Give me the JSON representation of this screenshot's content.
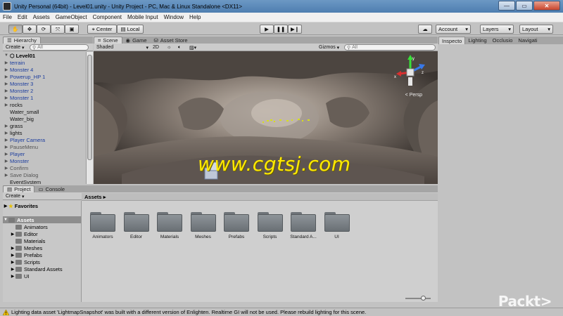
{
  "window": {
    "title": "Unity Personal (64bit) - Level01.unity - Unity Project - PC, Mac & Linux Standalone <DX11>"
  },
  "menu": [
    "File",
    "Edit",
    "Assets",
    "GameObject",
    "Component",
    "Mobile Input",
    "Window",
    "Help"
  ],
  "toolbar": {
    "pivot_label": "Center",
    "space_label": "Local",
    "account_label": "Account",
    "layers_label": "Layers",
    "layout_label": "Layout"
  },
  "hierarchy": {
    "tab": "Hierarchy",
    "create": "Create",
    "search_placeholder": "All",
    "scene_name": "Level01",
    "items": [
      {
        "label": "terrain",
        "style": "blue",
        "arrow": true
      },
      {
        "label": "Monster 4",
        "style": "blue",
        "arrow": true
      },
      {
        "label": "Powerup_HP 1",
        "style": "blue",
        "arrow": true
      },
      {
        "label": "Monster 3",
        "style": "blue",
        "arrow": true
      },
      {
        "label": "Monster 2",
        "style": "blue",
        "arrow": true
      },
      {
        "label": "Monster 1",
        "style": "blue",
        "arrow": true
      },
      {
        "label": "rocks",
        "style": "blk",
        "arrow": true
      },
      {
        "label": "Water_small",
        "style": "blk",
        "arrow": false
      },
      {
        "label": "Water_big",
        "style": "blk",
        "arrow": false
      },
      {
        "label": "grass",
        "style": "blk",
        "arrow": true
      },
      {
        "label": "lights",
        "style": "blk",
        "arrow": true
      },
      {
        "label": "Player Camera",
        "style": "blue",
        "arrow": true
      },
      {
        "label": "PauseMenu",
        "style": "dim",
        "arrow": true
      },
      {
        "label": "Player",
        "style": "blue",
        "arrow": true
      },
      {
        "label": "Monster",
        "style": "blue",
        "arrow": true
      },
      {
        "label": "Confirm",
        "style": "dim",
        "arrow": true
      },
      {
        "label": "Save Dialog",
        "style": "dim",
        "arrow": true
      },
      {
        "label": "EventSystem",
        "style": "blk",
        "arrow": false
      }
    ]
  },
  "scene": {
    "tabs": [
      "Scene",
      "Game",
      "Asset Store"
    ],
    "shading": "Shaded",
    "mode_2d": "2D",
    "gizmos": "Gizmos",
    "search_placeholder": "All",
    "persp_label": "< Persp",
    "watermark": "www.cgtsj.com"
  },
  "project": {
    "tabs": [
      "Project",
      "Console"
    ],
    "create": "Create",
    "favorites": "Favorites",
    "assets_root": "Assets",
    "tree": [
      "Animators",
      "Editor",
      "Materials",
      "Meshes",
      "Prefabs",
      "Scripts",
      "Standard Assets",
      "UI"
    ],
    "breadcrumb": "Assets",
    "grid_items": [
      "Animators",
      "Editor",
      "Materials",
      "Meshes",
      "Prefabs",
      "Scripts",
      "Standard A...",
      "UI"
    ]
  },
  "inspector": {
    "tabs": [
      "Inspecto",
      "Lighting",
      "Occlusio",
      "Navigati"
    ]
  },
  "status": {
    "message": "Lighting data asset 'LightmapSnapshot' was built with a different version of Enlighten. Realtime GI will not be used. Please rebuild lighting for this scene."
  },
  "branding": "Packt>",
  "colors": {
    "link_blue": "#1c3d9e",
    "watermark_yellow": "#ffea00",
    "selection_gray": "#8e8e8e"
  }
}
